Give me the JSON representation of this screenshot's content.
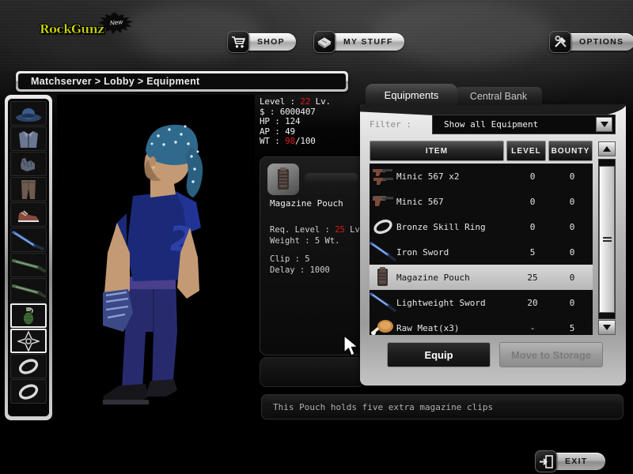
{
  "brand": {
    "logo_text": "RockGunz",
    "badge_text": "New",
    "logo_color": "#c8d400"
  },
  "topnav": {
    "items": [
      {
        "id": "shop",
        "label": "Shop",
        "icon": "shopping-cart-icon"
      },
      {
        "id": "my-stuff",
        "label": "My Stuff",
        "icon": "briefcase-icon"
      },
      {
        "id": "options",
        "label": "Options",
        "icon": "tools-icon"
      }
    ],
    "exit": {
      "label": "Exit",
      "icon": "exit-door-icon"
    }
  },
  "breadcrumb": {
    "text": "Matchserver > Lobby > Equipment"
  },
  "character": {
    "slots": [
      {
        "name": "head",
        "icon": "hat-icon",
        "highlighted": false
      },
      {
        "name": "chest",
        "icon": "jacket-icon",
        "highlighted": false
      },
      {
        "name": "hands",
        "icon": "gloves-icon",
        "highlighted": false
      },
      {
        "name": "legs",
        "icon": "pants-icon",
        "highlighted": false
      },
      {
        "name": "feet",
        "icon": "shoes-icon",
        "highlighted": false
      },
      {
        "name": "melee",
        "icon": "blue-sword-icon",
        "highlighted": false
      },
      {
        "name": "primary",
        "icon": "rifle-icon",
        "highlighted": false
      },
      {
        "name": "secondary",
        "icon": "rifle-icon",
        "highlighted": false
      },
      {
        "name": "grenade",
        "icon": "grenade-icon",
        "highlighted": true
      },
      {
        "name": "throwing",
        "icon": "shuriken-icon",
        "highlighted": true
      },
      {
        "name": "ring1",
        "icon": "ring-icon",
        "highlighted": false
      },
      {
        "name": "ring2",
        "icon": "ring-icon",
        "highlighted": false
      }
    ]
  },
  "stats": {
    "level_label": "Level : ",
    "level_value": "22",
    "level_suffix": " Lv.",
    "money_label": "$ : ",
    "money_value": "6000407",
    "hp_label": "HP : ",
    "hp_value": "124",
    "ap_label": "AP : ",
    "ap_value": "49",
    "wt_label": "WT : ",
    "wt_value": "98",
    "wt_max": "/100"
  },
  "detail": {
    "icon": "magazine-pouch-icon",
    "name": "Magazine Pouch",
    "req_level_label": "Req. Level : ",
    "req_level_value": "25",
    "req_level_suffix": " Lv.",
    "weight_line": "Weight : 5 Wt.",
    "clip_line": "Clip : 5",
    "delay_line": "Delay : 1000"
  },
  "description": {
    "text": "This Pouch holds five extra magazine clips"
  },
  "panel": {
    "tabs": [
      {
        "id": "equipments",
        "label": "Equipments",
        "active": true
      },
      {
        "id": "central-bank",
        "label": "Central Bank",
        "active": false
      }
    ],
    "filter": {
      "label": "Filter :",
      "value": "Show all Equipment",
      "options": [
        "Show all Equipment"
      ]
    },
    "columns": [
      "Item",
      "Level",
      "Bounty"
    ],
    "rows": [
      {
        "icon": "dual-pistol-icon",
        "name": "Minic 567 x2",
        "level": "0",
        "bounty": "0",
        "selected": false
      },
      {
        "icon": "pistol-icon",
        "name": "Minic 567",
        "level": "0",
        "bounty": "0",
        "selected": false
      },
      {
        "icon": "ring-icon",
        "name": "Bronze Skill Ring",
        "level": "0",
        "bounty": "0",
        "selected": false
      },
      {
        "icon": "sword-icon",
        "name": "Iron Sword",
        "level": "5",
        "bounty": "0",
        "selected": false
      },
      {
        "icon": "magazine-pouch-icon",
        "name": "Magazine Pouch",
        "level": "25",
        "bounty": "0",
        "selected": true
      },
      {
        "icon": "sword-icon",
        "name": "Lightweight Sword",
        "level": "20",
        "bounty": "0",
        "selected": false
      },
      {
        "icon": "meat-icon",
        "name": "Raw Meat(x3)",
        "level": "-",
        "bounty": "5",
        "selected": false
      }
    ],
    "buttons": {
      "equip": "Equip",
      "move_to_storage": "Move to Storage"
    }
  }
}
